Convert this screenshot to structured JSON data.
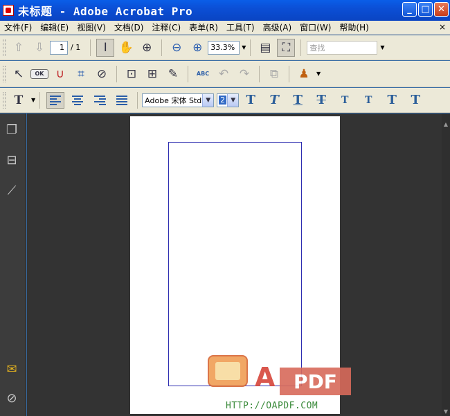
{
  "window": {
    "title": "未标题 - Adobe Acrobat Pro",
    "controls": {
      "minimize": "_",
      "maximize": "□",
      "close": "✕"
    }
  },
  "menubar": {
    "items": [
      {
        "label": "文件(F)"
      },
      {
        "label": "编辑(E)"
      },
      {
        "label": "视图(V)"
      },
      {
        "label": "文档(D)"
      },
      {
        "label": "注释(C)"
      },
      {
        "label": "表单(R)"
      },
      {
        "label": "工具(T)"
      },
      {
        "label": "高级(A)"
      },
      {
        "label": "窗口(W)"
      },
      {
        "label": "帮助(H)"
      }
    ],
    "close_glyph": "×"
  },
  "navigation": {
    "current_page": "1",
    "total_pages": "/ 1",
    "zoom": "33.3%",
    "find_placeholder": "查找"
  },
  "forms_toolbar": {
    "ok_label": "OK",
    "spell_label": "ABC"
  },
  "typewriter": {
    "font": "Adobe 宋体 Std",
    "size": "2",
    "styles": [
      "T",
      "T",
      "T",
      "T",
      "T",
      "T",
      "T",
      "T"
    ]
  },
  "watermark": {
    "letter": "A",
    "brand": "PDF",
    "url": "HTTP://OAPDF.COM"
  }
}
